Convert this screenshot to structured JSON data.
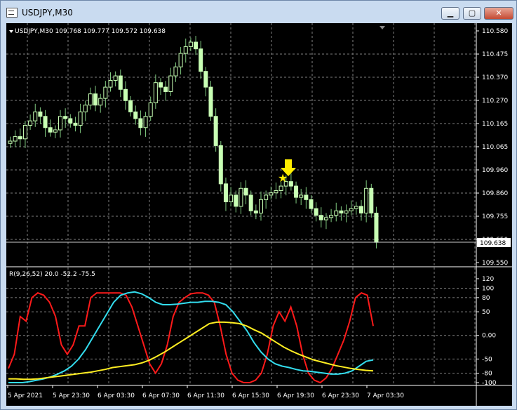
{
  "window": {
    "title": "USDJPY,M30",
    "buttons": {
      "minimize": "▁",
      "maximize": "▢",
      "close": "✕"
    }
  },
  "main_panel": {
    "header": "USDJPY,M30  109.768 109.777 109.572 109.638",
    "price_labels": [
      "110.580",
      "110.475",
      "110.370",
      "110.270",
      "110.165",
      "110.065",
      "109.960",
      "109.860",
      "109.755",
      "109.650",
      "109.550"
    ],
    "current_price": "109.638",
    "annotation_star": "★"
  },
  "sub_panel": {
    "header": "R(9,26,52) 20.0 -52.2 -75.5",
    "level_labels": [
      "120",
      "100",
      "80",
      "50",
      "0.00",
      "-50",
      "-80",
      "-100"
    ]
  },
  "time_axis": {
    "labels": [
      "5 Apr 2021",
      "5 Apr 23:30",
      "6 Apr 03:30",
      "6 Apr 07:30",
      "6 Apr 11:30",
      "6 Apr 15:30",
      "6 Apr 19:30",
      "6 Apr 23:30",
      "7 Apr 03:30"
    ]
  },
  "colors": {
    "background": "#000000",
    "grid": "#808080",
    "candle": "#c8ffb4",
    "wick": "#7fc97f",
    "text": "#ffffff",
    "red_line": "#ff1a1a",
    "cyan_line": "#33ddee",
    "yellow_line": "#ffee22",
    "arrow": "#ffee00"
  },
  "chart_data": {
    "type": "candlestick",
    "symbol": "USDJPY",
    "timeframe": "M30",
    "ohlc_last": {
      "open": 109.768,
      "high": 109.777,
      "low": 109.572,
      "close": 109.638
    },
    "ylim": [
      109.55,
      110.6
    ],
    "closes": [
      110.09,
      110.11,
      110.1,
      110.16,
      110.18,
      110.22,
      110.2,
      110.15,
      110.13,
      110.14,
      110.2,
      110.19,
      110.17,
      110.16,
      110.22,
      110.25,
      110.3,
      110.25,
      110.28,
      110.33,
      110.36,
      110.38,
      110.32,
      110.27,
      110.22,
      110.19,
      110.15,
      110.2,
      110.26,
      110.35,
      110.33,
      110.31,
      110.38,
      110.42,
      110.48,
      110.51,
      110.53,
      110.5,
      110.4,
      110.33,
      110.2,
      110.07,
      109.9,
      109.82,
      109.85,
      109.8,
      109.88,
      109.85,
      109.78,
      109.77,
      109.83,
      109.85,
      109.86,
      109.87,
      109.89,
      109.91,
      109.89,
      109.84,
      109.85,
      109.83,
      109.79,
      109.76,
      109.74,
      109.75,
      109.76,
      109.78,
      109.77,
      109.78,
      109.79,
      109.8,
      109.77,
      109.88,
      109.77,
      109.64
    ],
    "indicator": {
      "name": "R(9,26,52)",
      "values_shown": [
        20.0,
        -52.2,
        -75.5
      ],
      "levels": [
        120,
        100,
        80,
        50,
        0,
        -50,
        -80,
        -100
      ],
      "ylim": [
        -100,
        120
      ],
      "series": [
        {
          "color": "red",
          "values": [
            -70,
            -40,
            40,
            30,
            80,
            90,
            85,
            70,
            40,
            -20,
            -40,
            -20,
            20,
            20,
            80,
            90,
            90,
            90,
            90,
            90,
            85,
            60,
            20,
            -20,
            -60,
            -80,
            -60,
            -20,
            40,
            70,
            80,
            88,
            90,
            90,
            85,
            70,
            20,
            -40,
            -80,
            -95,
            -100,
            -100,
            -95,
            -80,
            -40,
            20,
            50,
            30,
            60,
            20,
            -40,
            -80,
            -95,
            -100,
            -90,
            -70,
            -40,
            -10,
            30,
            80,
            90,
            85,
            20
          ]
        },
        {
          "color": "cyan",
          "values": [
            -100,
            -100,
            -100,
            -98,
            -95,
            -92,
            -88,
            -82,
            -75,
            -65,
            -50,
            -30,
            -5,
            20,
            45,
            70,
            85,
            90,
            92,
            88,
            80,
            70,
            65,
            65,
            66,
            68,
            70,
            70,
            72,
            72,
            70,
            65,
            50,
            30,
            10,
            -15,
            -35,
            -50,
            -60,
            -65,
            -68,
            -72,
            -75,
            -76,
            -78,
            -80,
            -82,
            -82,
            -80,
            -75,
            -65,
            -55,
            -52
          ]
        },
        {
          "color": "yellow",
          "values": [
            -92,
            -92,
            -93,
            -93,
            -92,
            -90,
            -88,
            -86,
            -84,
            -82,
            -80,
            -78,
            -75,
            -72,
            -68,
            -66,
            -64,
            -62,
            -58,
            -52,
            -44,
            -35,
            -25,
            -15,
            -5,
            5,
            15,
            25,
            28,
            28,
            27,
            25,
            20,
            12,
            5,
            -5,
            -15,
            -25,
            -33,
            -40,
            -46,
            -52,
            -56,
            -60,
            -64,
            -67,
            -70,
            -72,
            -74,
            -75
          ]
        }
      ]
    }
  }
}
